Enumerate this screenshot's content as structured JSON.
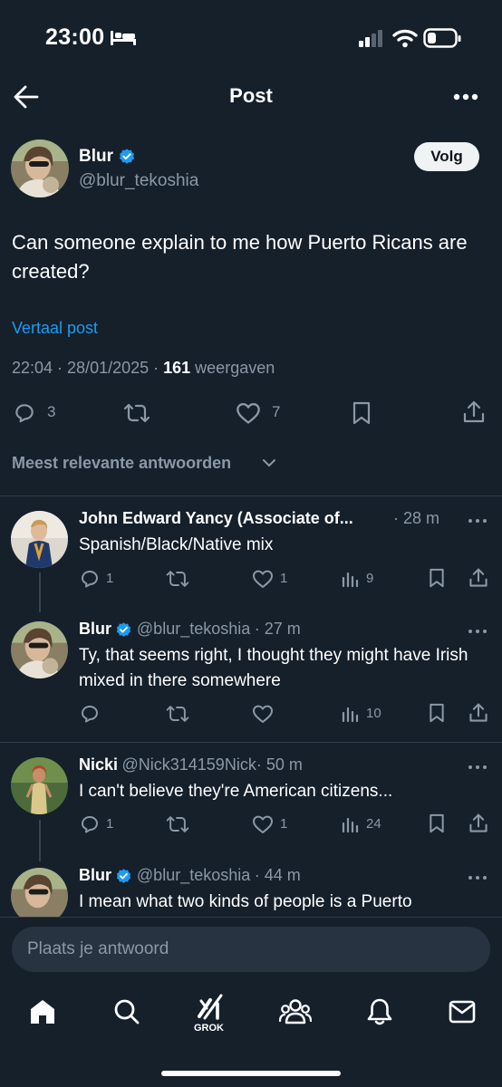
{
  "status_bar": {
    "time": "23:00"
  },
  "header": {
    "title": "Post"
  },
  "post": {
    "author": {
      "name": "Blur",
      "handle": "@blur_tekoshia"
    },
    "follow_label": "Volg",
    "text": "Can someone explain to me how Puerto Ricans are created?",
    "translate_label": "Vertaal post",
    "meta": {
      "time_date": "22:04 · 28/01/2025 · ",
      "views_count": "161",
      "views_label": " weergaven"
    },
    "actions": {
      "replies": "3",
      "likes": "7"
    }
  },
  "replies_sort": {
    "label": "Meest relevante antwoorden"
  },
  "replies": [
    {
      "name": "John Edward Yancy (Associate of...",
      "handle": "",
      "time": "· 28 m",
      "text": "Spanish/Black/Native mix",
      "replies": "1",
      "reposts": "",
      "likes": "1",
      "views": "9"
    },
    {
      "name": "Blur",
      "handle": "@blur_tekoshia",
      "time": "· 27 m",
      "text": "Ty, that seems right, I thought they might have Irish mixed in there somewhere",
      "replies": "",
      "reposts": "",
      "likes": "",
      "views": "10"
    },
    {
      "name": "Nicki",
      "handle": "@Nick314159Nick",
      "time": "· 50 m",
      "text": "I can't believe they're American citizens...",
      "replies": "1",
      "reposts": "",
      "likes": "1",
      "views": "24"
    },
    {
      "name": "Blur",
      "handle": "@blur_tekoshia",
      "time": "· 44 m",
      "text": "I mean what two kinds of people is a Puerto"
    }
  ],
  "compose": {
    "placeholder": "Plaats je antwoord"
  },
  "tabbar": {
    "grok_label": "GROK"
  },
  "colors": {
    "background": "#15202b",
    "accent": "#1d9bf0",
    "muted": "#8b98a5",
    "text": "#e7e9ea"
  }
}
